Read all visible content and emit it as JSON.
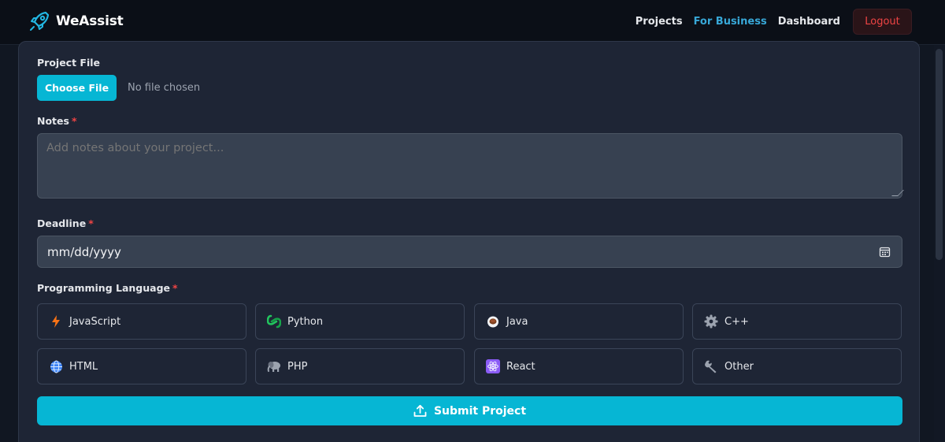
{
  "navbar": {
    "brand": "WeAssist",
    "links": [
      "Projects",
      "For Business",
      "Dashboard"
    ],
    "logout_label": "Logout",
    "accent_color": "#38a8d8"
  },
  "form": {
    "project_file": {
      "label": "Project File",
      "button_label": "Choose File",
      "status": "No file chosen"
    },
    "notes": {
      "label": "Notes",
      "required_mark": "*",
      "placeholder": "Add notes about your project...",
      "value": ""
    },
    "deadline": {
      "label": "Deadline",
      "required_mark": "*",
      "placeholder": "mm/dd/yyyy"
    },
    "language": {
      "label": "Programming Language",
      "required_mark": "*",
      "options": [
        {
          "label": "JavaScript",
          "icon": "lightning-icon"
        },
        {
          "label": "Python",
          "icon": "python-icon"
        },
        {
          "label": "Java",
          "icon": "coffee-icon"
        },
        {
          "label": "C++",
          "icon": "gear-icon"
        },
        {
          "label": "HTML",
          "icon": "globe-icon"
        },
        {
          "label": "PHP",
          "icon": "elephant-icon"
        },
        {
          "label": "React",
          "icon": "atom-icon"
        },
        {
          "label": "Other",
          "icon": "wrench-icon"
        }
      ]
    },
    "submit_label": "Submit Project"
  },
  "colors": {
    "primary": "#06b6d4",
    "background": "#111722",
    "card": "#1e2535",
    "danger": "#ef4444"
  }
}
